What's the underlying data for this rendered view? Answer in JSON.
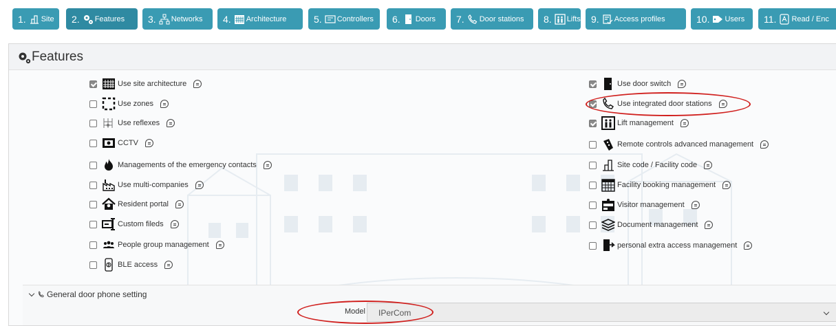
{
  "steps": [
    {
      "num": "1.",
      "label": "Site",
      "icon": "site-icon"
    },
    {
      "num": "2.",
      "label": "Features",
      "icon": "gears-icon"
    },
    {
      "num": "3.",
      "label": "Networks",
      "icon": "network-icon"
    },
    {
      "num": "4.",
      "label": "Architecture",
      "icon": "building-icon"
    },
    {
      "num": "5.",
      "label": "Controllers",
      "icon": "controller-icon"
    },
    {
      "num": "6.",
      "label": "Doors",
      "icon": "door-icon"
    },
    {
      "num": "7.",
      "label": "Door stations",
      "icon": "phone-icon"
    },
    {
      "num": "8.",
      "label": "Lifts",
      "icon": "lift-icon"
    },
    {
      "num": "9.",
      "label": "Access profiles",
      "icon": "access-profile-icon"
    },
    {
      "num": "10.",
      "label": "Users",
      "icon": "users-tag-icon"
    },
    {
      "num": "11.",
      "label": "Read / Enc",
      "icon": "reader-icon"
    }
  ],
  "features_panel": {
    "title": "Features",
    "left": [
      {
        "label": "Use site architecture",
        "checked": true,
        "icon": "building-icon"
      },
      {
        "label": "Use zones",
        "checked": false,
        "icon": "zone-icon"
      },
      {
        "label": "Use reflexes",
        "checked": false,
        "icon": "reflex-icon"
      },
      {
        "label": "CCTV",
        "checked": false,
        "icon": "cctv-icon"
      },
      {
        "label": "Managements of the emergency contacts",
        "checked": false,
        "icon": "fire-icon"
      },
      {
        "label": "Use multi-companies",
        "checked": false,
        "icon": "factory-icon"
      },
      {
        "label": "Resident portal",
        "checked": false,
        "icon": "house-icon"
      },
      {
        "label": "Custom fileds",
        "checked": false,
        "icon": "custom-field-icon"
      },
      {
        "label": "People group management",
        "checked": false,
        "icon": "people-group-icon"
      },
      {
        "label": "BLE access",
        "checked": false,
        "icon": "ble-phone-icon"
      }
    ],
    "right": [
      {
        "label": "Use door switch",
        "checked": true,
        "icon": "door-icon"
      },
      {
        "label": "Use integrated door stations",
        "checked": true,
        "icon": "phone-icon"
      },
      {
        "label": "Lift management",
        "checked": true,
        "icon": "lift-icon"
      },
      {
        "label": "Remote controls advanced management",
        "checked": false,
        "icon": "remote-control-icon"
      },
      {
        "label": "Site code / Facility code",
        "checked": false,
        "icon": "site-code-icon"
      },
      {
        "label": "Facility booking management",
        "checked": false,
        "icon": "calendar-icon"
      },
      {
        "label": "Visitor management",
        "checked": false,
        "icon": "visitor-icon"
      },
      {
        "label": "Document management",
        "checked": false,
        "icon": "documents-icon"
      },
      {
        "label": "personal extra access management",
        "checked": false,
        "icon": "personal-access-icon"
      }
    ]
  },
  "door_phone_setting": {
    "title": "General door phone setting",
    "model_label": "Model",
    "model_value": "IPerCom"
  },
  "colors": {
    "step_bg": "#3a9bb3",
    "annotation_ring": "#d0201e"
  }
}
